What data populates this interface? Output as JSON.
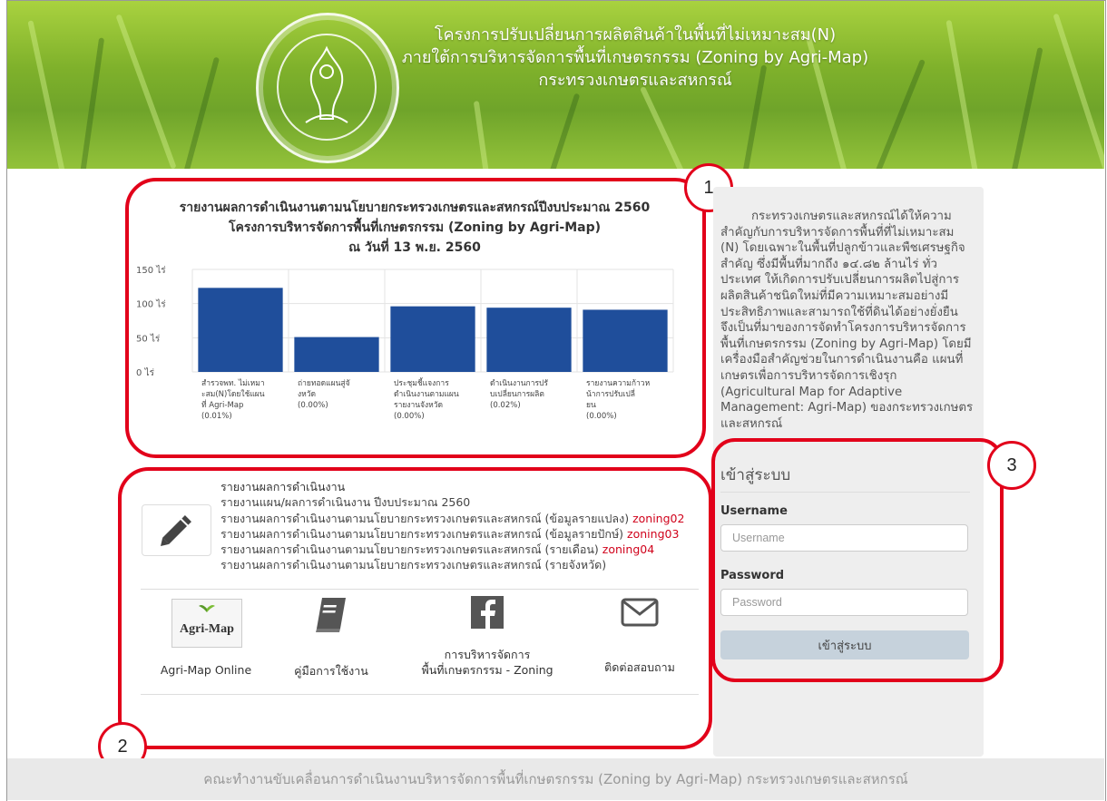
{
  "header": {
    "title_line1": "โครงการปรับเปลี่ยนการผลิตสินค้าในพื้นที่ไม่เหมาะสม(N)",
    "title_line2": "ภายใต้การบริหารจัดการพื้นที่เกษตรกรรม (Zoning by Agri-Map)",
    "title_line3": "กระทรวงเกษตรและสหกรณ์"
  },
  "chart_data": {
    "type": "bar",
    "title": "รายงานผลการดำเนินงานตามนโยบายกระทรวงเกษตรและสหกรณ์ปีงบประมาณ 2560",
    "subtitle": "โครงการบริหารจัดการพื้นที่เกษตรกรรม (Zoning by Agri-Map)",
    "date": "ณ วันที่ 13 พ.ย. 2560",
    "y_ticks": [
      "150 ไร่",
      "100 ไร่",
      "50 ไร่",
      "0 ไร่"
    ],
    "ylim": [
      0,
      150
    ],
    "categories": [
      [
        "สำรวจพท. ไม่เหมา",
        "ะสม(N)โดยใช้แผน",
        "ที่ Agri-Map",
        "(0.01%)"
      ],
      [
        "ถ่ายทอดแผนสู่จั",
        "งหวัด",
        "(0.00%)"
      ],
      [
        "ประชุมชี้แจงการ",
        "ดำเนินงานตามแผน",
        "รายงานจังหวัด",
        "(0.00%)"
      ],
      [
        "ดำเนินงานการปรั",
        "บเปลี่ยนการผลิต",
        "(0.02%)"
      ],
      [
        "รายงานความก้าวห",
        "น้าการปรับเปลี่",
        "ยน",
        "(0.00%)"
      ]
    ],
    "values": [
      123,
      51,
      96,
      94,
      91
    ],
    "bar_color": "#1f4e9b",
    "grid": true
  },
  "report": {
    "heading": "รายงานผลการดำเนินงาน",
    "line1": "รายงานแผน/ผลการดำเนินงาน ปีงบประมาณ 2560",
    "line2": "รายงานผลการดำเนินงานตามนโยบายกระทรวงเกษตรและสหกรณ์ (ข้อมูลรายแปลง)",
    "line2_code": "zoning02",
    "line3": "รายงานผลการดำเนินงานตามนโยบายกระทรวงเกษตรและสหกรณ์ (ข้อมูลรายปักษ์)",
    "line3_code": "zoning03",
    "line4": "รายงานผลการดำเนินงานตามนโยบายกระทรวงเกษตรและสหกรณ์ (รายเดือน)",
    "line4_code": "zoning04",
    "line5": "รายงานผลการดำเนินงานตามนโยบายกระทรวงเกษตรและสหกรณ์ (รายจังหวัด)"
  },
  "quick_links": {
    "agrimap_logo_text": "Agri-Map",
    "agrimap": "Agri-Map Online",
    "manual": "คู่มือการใช้งาน",
    "zoning_line1": "การบริหารจัดการ",
    "zoning_line2": "พื้นที่เกษตรกรรม - Zoning",
    "contact": "ติดต่อสอบถาม"
  },
  "side_info": {
    "text": "กระทรวงเกษตรและสหกรณ์ได้ให้ความสำคัญกับการบริหารจัดการพื้นที่ที่ไม่เหมาะสม (N) โดยเฉพาะในพื้นที่ปลูกข้าวและพืชเศรษฐกิจสำคัญ ซึ่งมีพื้นที่มากถึง ๑๔.๘๒ ล้านไร่ ทั่วประเทศ ให้เกิดการปรับเปลี่ยนการผลิตไปสู่การผลิตสินค้าชนิดใหม่ที่มีความเหมาะสมอย่างมีประสิทธิภาพและสามารถใช้ที่ดินได้อย่างยั่งยืน จึงเป็นที่มาของการจัดทำโครงการบริหารจัดการพื้นที่เกษตรกรรม (Zoning by Agri-Map) โดยมีเครื่องมือสำคัญช่วยในการดำเนินงานคือ แผนที่เกษตรเพื่อการบริหารจัดการเชิงรุก (Agricultural Map for Adaptive Management: Agri-Map) ของกระทรวงเกษตรและสหกรณ์"
  },
  "login": {
    "title": "เข้าสู่ระบบ",
    "username_label": "Username",
    "username_placeholder": "Username",
    "password_label": "Password",
    "password_placeholder": "Password",
    "submit": "เข้าสู่ระบบ"
  },
  "annotations": {
    "one": "1",
    "two": "2",
    "three": "3",
    "ring_color": "#e2001a"
  },
  "footer": {
    "text": "คณะทำงานขับเคลื่อนการดำเนินงานบริหารจัดการพื้นที่เกษตรกรรม (Zoning by Agri-Map) กระทรวงเกษตรและสหกรณ์"
  }
}
